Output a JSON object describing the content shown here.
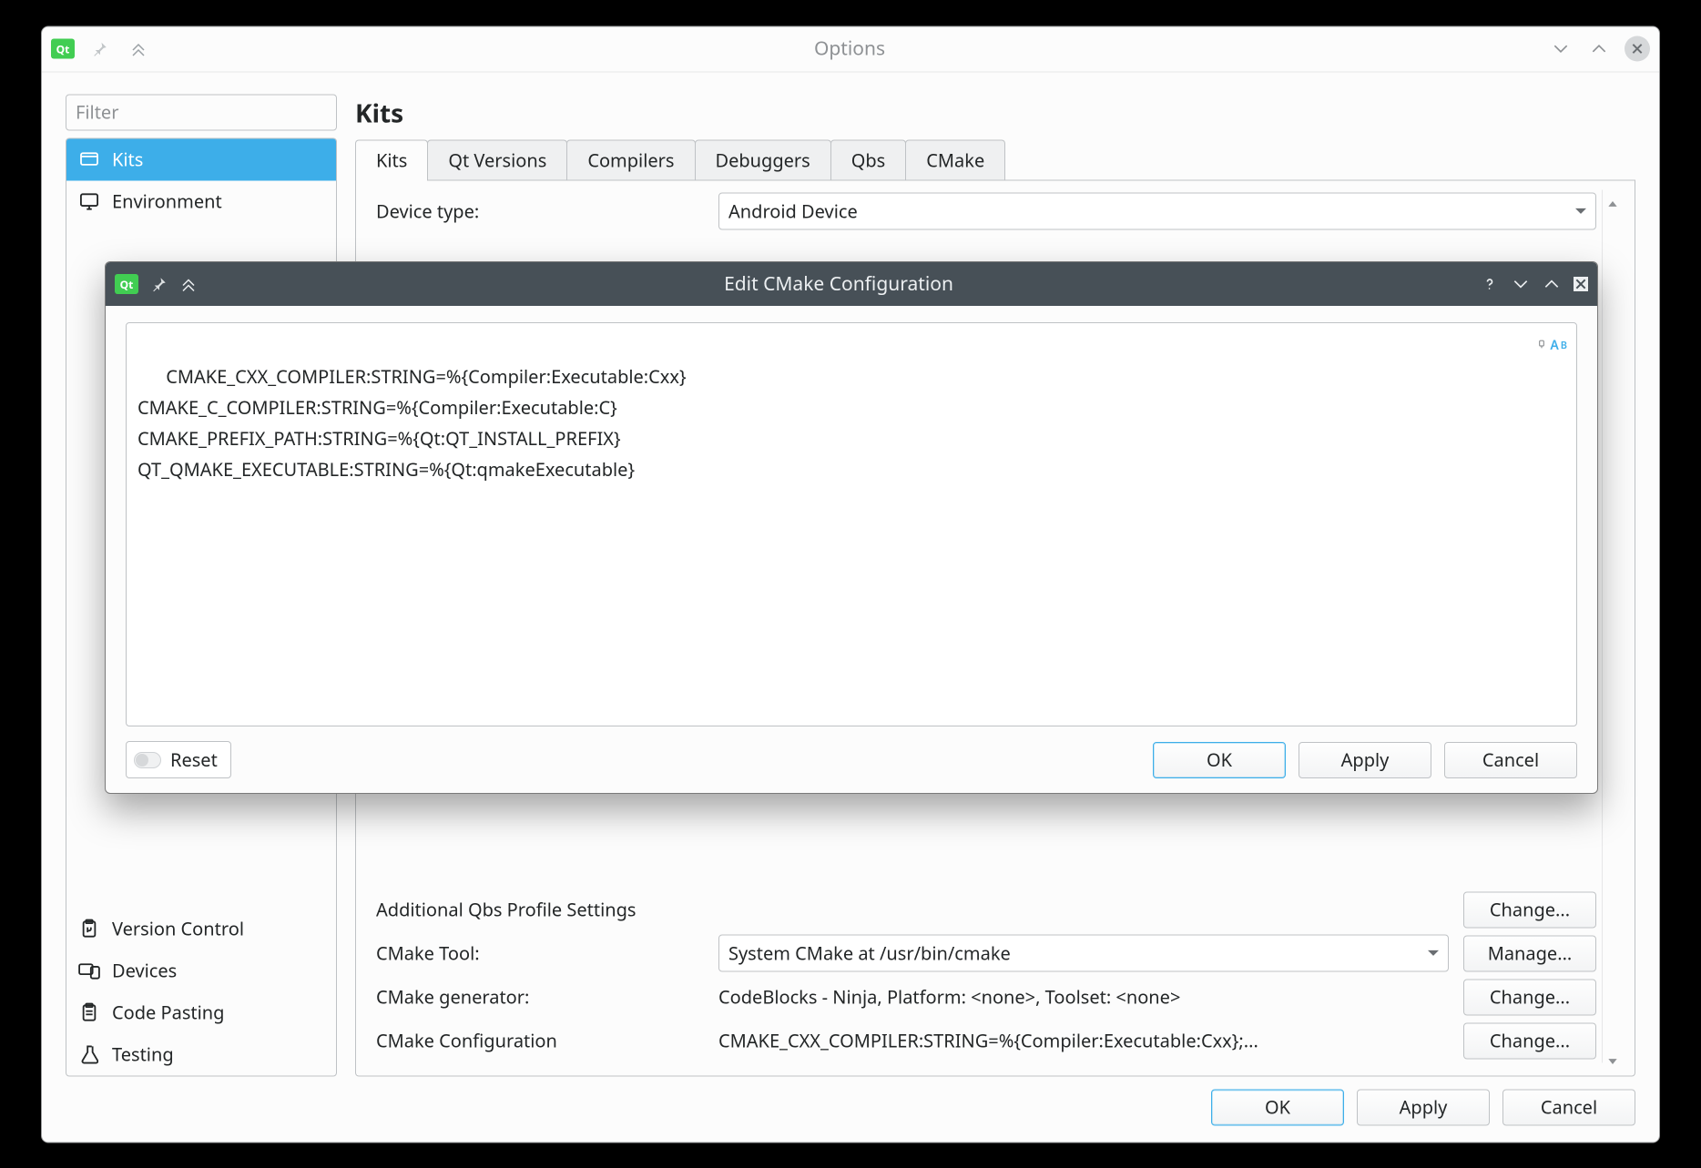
{
  "options_window": {
    "title": "Options",
    "filter_placeholder": "Filter",
    "heading": "Kits",
    "categories": [
      {
        "label": "Kits",
        "icon": "kit-icon",
        "selected": true
      },
      {
        "label": "Environment",
        "icon": "monitor-icon"
      },
      {
        "label": "Version Control",
        "icon": "clipboard-branch-icon"
      },
      {
        "label": "Devices",
        "icon": "devices-icon"
      },
      {
        "label": "Code Pasting",
        "icon": "clipboard-icon"
      },
      {
        "label": "Testing",
        "icon": "flask-icon"
      }
    ],
    "tabs": [
      "Kits",
      "Qt Versions",
      "Compilers",
      "Debuggers",
      "Qbs",
      "CMake"
    ],
    "active_tab": "Kits",
    "rows": {
      "device_type": {
        "label": "Device type:",
        "value": "Android Device",
        "kind": "select"
      },
      "qbs": {
        "label": "Additional Qbs Profile Settings",
        "button": "Change..."
      },
      "cmake_tool": {
        "label": "CMake Tool:",
        "value": "System CMake at /usr/bin/cmake",
        "kind": "select",
        "button": "Manage..."
      },
      "cmake_gen": {
        "label": "CMake generator:",
        "value": "CodeBlocks - Ninja, Platform: <none>, Toolset: <none>",
        "button": "Change..."
      },
      "cmake_cfg": {
        "label": "CMake Configuration",
        "value": "CMAKE_CXX_COMPILER:STRING=%{Compiler:Executable:Cxx};...",
        "button": "Change..."
      }
    },
    "buttons": {
      "ok": "OK",
      "apply": "Apply",
      "cancel": "Cancel"
    }
  },
  "dialog": {
    "title": "Edit CMake Configuration",
    "editor_text": "CMAKE_CXX_COMPILER:STRING=%{Compiler:Executable:Cxx}\nCMAKE_C_COMPILER:STRING=%{Compiler:Executable:C}\nCMAKE_PREFIX_PATH:STRING=%{Qt:QT_INSTALL_PREFIX}\nQT_QMAKE_EXECUTABLE:STRING=%{Qt:qmakeExecutable}",
    "reset_label": "Reset",
    "buttons": {
      "ok": "OK",
      "apply": "Apply",
      "cancel": "Cancel"
    }
  }
}
